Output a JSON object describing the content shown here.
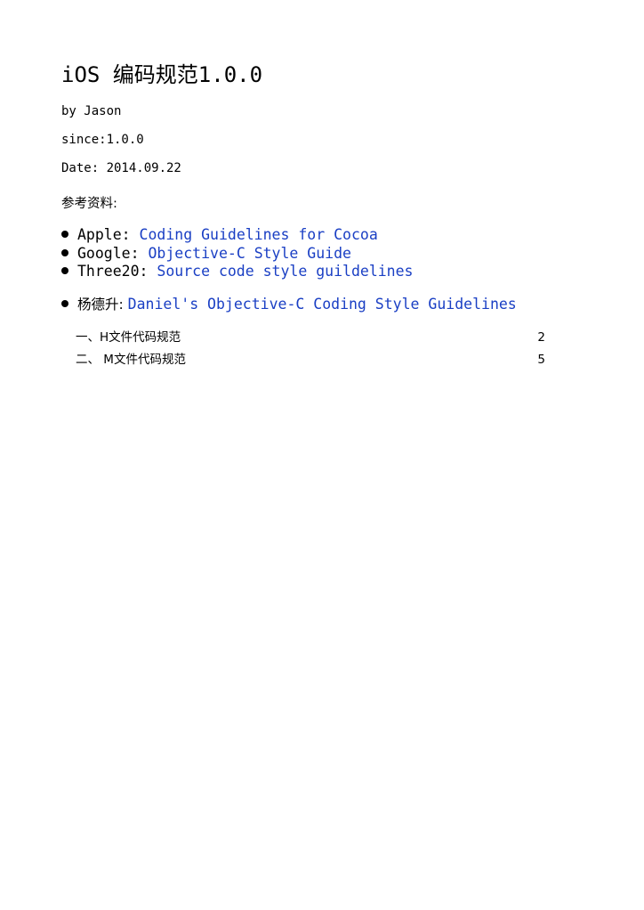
{
  "document": {
    "title": "iOS 编码规范1.0.0",
    "author": "by Jason",
    "since": "since:1.0.0",
    "date": "Date: 2014.09.22",
    "references_heading": "参考资料:",
    "references": [
      {
        "source": "Apple: ",
        "link_text": "Coding Guidelines for Cocoa"
      },
      {
        "source": "Google: ",
        "link_text": "Objective-C Style Guide"
      },
      {
        "source": "Three20: ",
        "link_text": "Source code style guildelines"
      },
      {
        "source": "杨德升: ",
        "link_text": "Daniel's Objective-C Coding Style Guidelines"
      }
    ],
    "toc": [
      {
        "label": "一、H文件代码规范",
        "page": "2"
      },
      {
        "label": "二、 M文件代码规范",
        "page": "5"
      }
    ]
  },
  "colors": {
    "link": "#1a3fc4",
    "text": "#000000",
    "background": "#ffffff"
  }
}
